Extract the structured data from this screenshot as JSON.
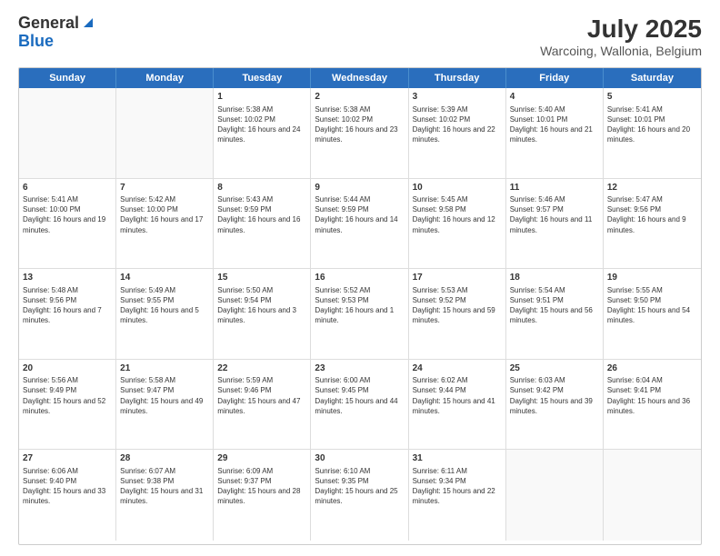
{
  "header": {
    "logo_general": "General",
    "logo_blue": "Blue",
    "title": "July 2025",
    "location": "Warcoing, Wallonia, Belgium"
  },
  "days_of_week": [
    "Sunday",
    "Monday",
    "Tuesday",
    "Wednesday",
    "Thursday",
    "Friday",
    "Saturday"
  ],
  "weeks": [
    {
      "cells": [
        {
          "day": "",
          "info": ""
        },
        {
          "day": "",
          "info": ""
        },
        {
          "day": "1",
          "info": "Sunrise: 5:38 AM\nSunset: 10:02 PM\nDaylight: 16 hours and 24 minutes."
        },
        {
          "day": "2",
          "info": "Sunrise: 5:38 AM\nSunset: 10:02 PM\nDaylight: 16 hours and 23 minutes."
        },
        {
          "day": "3",
          "info": "Sunrise: 5:39 AM\nSunset: 10:02 PM\nDaylight: 16 hours and 22 minutes."
        },
        {
          "day": "4",
          "info": "Sunrise: 5:40 AM\nSunset: 10:01 PM\nDaylight: 16 hours and 21 minutes."
        },
        {
          "day": "5",
          "info": "Sunrise: 5:41 AM\nSunset: 10:01 PM\nDaylight: 16 hours and 20 minutes."
        }
      ]
    },
    {
      "cells": [
        {
          "day": "6",
          "info": "Sunrise: 5:41 AM\nSunset: 10:00 PM\nDaylight: 16 hours and 19 minutes."
        },
        {
          "day": "7",
          "info": "Sunrise: 5:42 AM\nSunset: 10:00 PM\nDaylight: 16 hours and 17 minutes."
        },
        {
          "day": "8",
          "info": "Sunrise: 5:43 AM\nSunset: 9:59 PM\nDaylight: 16 hours and 16 minutes."
        },
        {
          "day": "9",
          "info": "Sunrise: 5:44 AM\nSunset: 9:59 PM\nDaylight: 16 hours and 14 minutes."
        },
        {
          "day": "10",
          "info": "Sunrise: 5:45 AM\nSunset: 9:58 PM\nDaylight: 16 hours and 12 minutes."
        },
        {
          "day": "11",
          "info": "Sunrise: 5:46 AM\nSunset: 9:57 PM\nDaylight: 16 hours and 11 minutes."
        },
        {
          "day": "12",
          "info": "Sunrise: 5:47 AM\nSunset: 9:56 PM\nDaylight: 16 hours and 9 minutes."
        }
      ]
    },
    {
      "cells": [
        {
          "day": "13",
          "info": "Sunrise: 5:48 AM\nSunset: 9:56 PM\nDaylight: 16 hours and 7 minutes."
        },
        {
          "day": "14",
          "info": "Sunrise: 5:49 AM\nSunset: 9:55 PM\nDaylight: 16 hours and 5 minutes."
        },
        {
          "day": "15",
          "info": "Sunrise: 5:50 AM\nSunset: 9:54 PM\nDaylight: 16 hours and 3 minutes."
        },
        {
          "day": "16",
          "info": "Sunrise: 5:52 AM\nSunset: 9:53 PM\nDaylight: 16 hours and 1 minute."
        },
        {
          "day": "17",
          "info": "Sunrise: 5:53 AM\nSunset: 9:52 PM\nDaylight: 15 hours and 59 minutes."
        },
        {
          "day": "18",
          "info": "Sunrise: 5:54 AM\nSunset: 9:51 PM\nDaylight: 15 hours and 56 minutes."
        },
        {
          "day": "19",
          "info": "Sunrise: 5:55 AM\nSunset: 9:50 PM\nDaylight: 15 hours and 54 minutes."
        }
      ]
    },
    {
      "cells": [
        {
          "day": "20",
          "info": "Sunrise: 5:56 AM\nSunset: 9:49 PM\nDaylight: 15 hours and 52 minutes."
        },
        {
          "day": "21",
          "info": "Sunrise: 5:58 AM\nSunset: 9:47 PM\nDaylight: 15 hours and 49 minutes."
        },
        {
          "day": "22",
          "info": "Sunrise: 5:59 AM\nSunset: 9:46 PM\nDaylight: 15 hours and 47 minutes."
        },
        {
          "day": "23",
          "info": "Sunrise: 6:00 AM\nSunset: 9:45 PM\nDaylight: 15 hours and 44 minutes."
        },
        {
          "day": "24",
          "info": "Sunrise: 6:02 AM\nSunset: 9:44 PM\nDaylight: 15 hours and 41 minutes."
        },
        {
          "day": "25",
          "info": "Sunrise: 6:03 AM\nSunset: 9:42 PM\nDaylight: 15 hours and 39 minutes."
        },
        {
          "day": "26",
          "info": "Sunrise: 6:04 AM\nSunset: 9:41 PM\nDaylight: 15 hours and 36 minutes."
        }
      ]
    },
    {
      "cells": [
        {
          "day": "27",
          "info": "Sunrise: 6:06 AM\nSunset: 9:40 PM\nDaylight: 15 hours and 33 minutes."
        },
        {
          "day": "28",
          "info": "Sunrise: 6:07 AM\nSunset: 9:38 PM\nDaylight: 15 hours and 31 minutes."
        },
        {
          "day": "29",
          "info": "Sunrise: 6:09 AM\nSunset: 9:37 PM\nDaylight: 15 hours and 28 minutes."
        },
        {
          "day": "30",
          "info": "Sunrise: 6:10 AM\nSunset: 9:35 PM\nDaylight: 15 hours and 25 minutes."
        },
        {
          "day": "31",
          "info": "Sunrise: 6:11 AM\nSunset: 9:34 PM\nDaylight: 15 hours and 22 minutes."
        },
        {
          "day": "",
          "info": ""
        },
        {
          "day": "",
          "info": ""
        }
      ]
    }
  ]
}
